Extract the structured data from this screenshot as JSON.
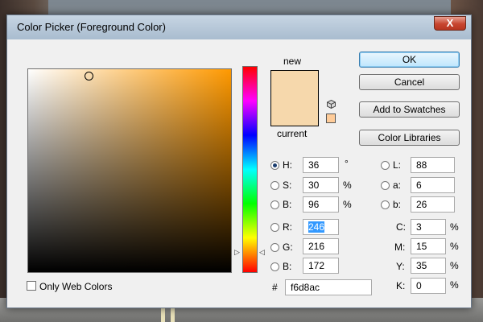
{
  "window": {
    "title": "Color Picker (Foreground Color)",
    "close_glyph": "X"
  },
  "swatch": {
    "new_label": "new",
    "current_label": "current",
    "new_color": "#f6d8ac",
    "current_color": "#f6d8ac",
    "web_safe_color": "#ffcc99"
  },
  "buttons": {
    "ok": "OK",
    "cancel": "Cancel",
    "add_to_swatches": "Add to Swatches",
    "color_libraries": "Color Libraries"
  },
  "hsb": {
    "h": {
      "label": "H:",
      "value": "36",
      "unit": "°"
    },
    "s": {
      "label": "S:",
      "value": "30",
      "unit": "%"
    },
    "b": {
      "label": "B:",
      "value": "96",
      "unit": "%"
    }
  },
  "rgb": {
    "r": {
      "label": "R:",
      "value": "246"
    },
    "g": {
      "label": "G:",
      "value": "216"
    },
    "b": {
      "label": "B:",
      "value": "172"
    }
  },
  "lab": {
    "l": {
      "label": "L:",
      "value": "88"
    },
    "a": {
      "label": "a:",
      "value": "6"
    },
    "b": {
      "label": "b:",
      "value": "26"
    }
  },
  "cmyk": {
    "c": {
      "label": "C:",
      "value": "3",
      "unit": "%"
    },
    "m": {
      "label": "M:",
      "value": "15",
      "unit": "%"
    },
    "y": {
      "label": "Y:",
      "value": "35",
      "unit": "%"
    },
    "k": {
      "label": "K:",
      "value": "0",
      "unit": "%"
    }
  },
  "hex": {
    "label": "#",
    "value": "f6d8ac"
  },
  "only_web_colors": {
    "label": "Only Web Colors",
    "checked": false
  },
  "selected_channel": "H",
  "colors": {
    "field_hue": "#ff9900",
    "hue_ramp_start": "#ff0000"
  }
}
